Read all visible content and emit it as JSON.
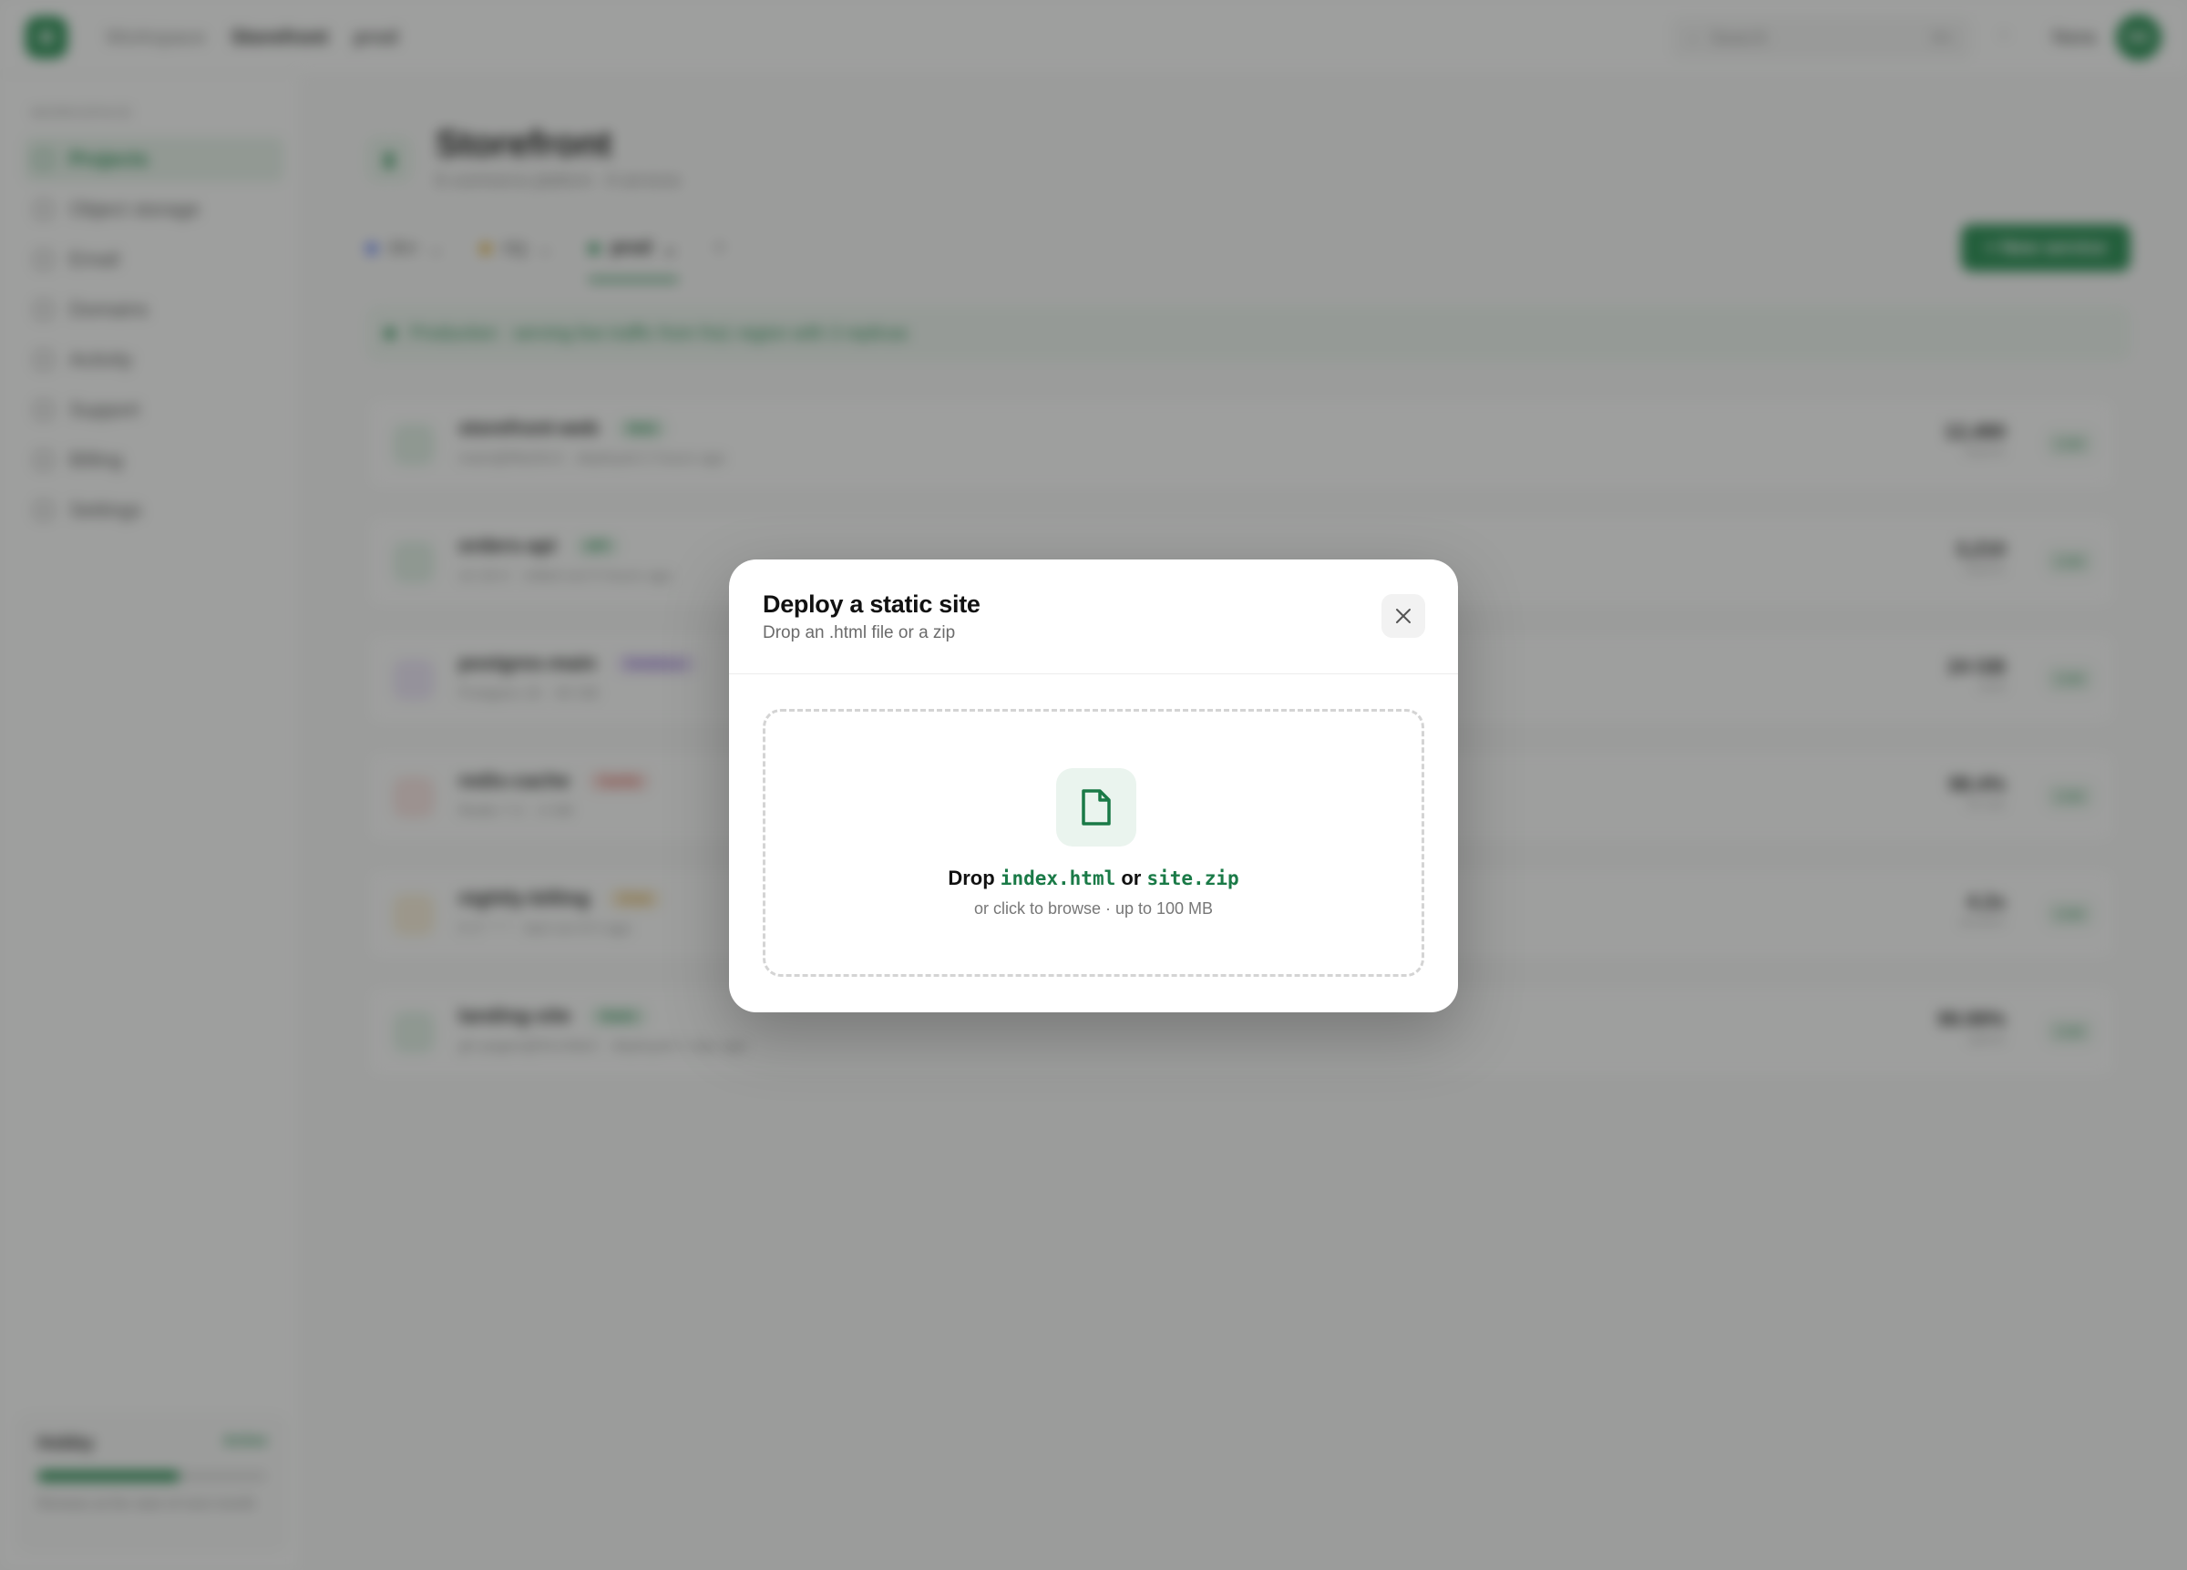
{
  "topbar": {
    "logo_glyph": "✿",
    "breadcrumbs": [
      "Workspace",
      "Storefront",
      "prod"
    ],
    "search_placeholder": "Search",
    "search_shortcut": "⌘K",
    "user_name": "Nora",
    "avatar_initials": "NS"
  },
  "sidebar": {
    "section_label": "Workspace",
    "items": [
      {
        "label": "Projects",
        "active": true
      },
      {
        "label": "Object storage",
        "active": false
      },
      {
        "label": "Email",
        "active": false
      },
      {
        "label": "Domains",
        "active": false
      },
      {
        "label": "Activity",
        "active": false
      },
      {
        "label": "Support",
        "active": false
      },
      {
        "label": "Billing",
        "active": false
      },
      {
        "label": "Settings",
        "active": false
      }
    ],
    "plan": {
      "name": "Hobby",
      "badge": "Active",
      "usage_fraction": 0.62,
      "note": "Renews at the start of next month"
    }
  },
  "main": {
    "project_title": "Storefront",
    "project_subtitle": "E-commerce platform · 6 services",
    "env_tabs": [
      {
        "label": "dev",
        "color": "#4a6cf7",
        "active": false
      },
      {
        "label": "stg",
        "color": "#e0a31b",
        "active": false
      },
      {
        "label": "prod",
        "color": "#1f8a4c",
        "active": true
      }
    ],
    "new_service_label": "+ New service",
    "banner_text": "Production · serving live traffic from fra1 region with 3 replicas",
    "services": [
      {
        "name": "storefront-web",
        "tag": "Web",
        "tag_color": "#1f8a4c",
        "tag_bg": "#e3f2e8",
        "icon_bg": "#e3f2e8",
        "meta": "main@8fa20c3 · deployed 2 hours ago",
        "value": "12,480",
        "unit": "req/min",
        "status": "Live"
      },
      {
        "name": "orders-api",
        "tag": "API",
        "tag_color": "#1f8a4c",
        "tag_bg": "#e3f2e8",
        "icon_bg": "#e3f2e8",
        "meta": "v2.18.4 · rolled out 5 hours ago",
        "value": "3,210",
        "unit": "req/min",
        "status": "Live"
      },
      {
        "name": "postgres-main",
        "tag": "Database",
        "tag_color": "#7a55c9",
        "tag_bg": "#efe8fa",
        "icon_bg": "#efe8fa",
        "meta": "Postgres 16 · 40 GB",
        "value": "24 GB",
        "unit": "used",
        "status": "Live"
      },
      {
        "name": "redis-cache",
        "tag": "Cache",
        "tag_color": "#d1453b",
        "tag_bg": "#fbe7e5",
        "icon_bg": "#fbe7e5",
        "meta": "Redis 7.2 · 2 GB",
        "value": "98.4%",
        "unit": "hit rate",
        "status": "Live"
      },
      {
        "name": "nightly-billing",
        "tag": "Cron",
        "tag_color": "#c98a0f",
        "tag_bg": "#fbf1dc",
        "icon_bg": "#fbf1dc",
        "meta": "0 3 * * * · last run 8 h ago",
        "value": "4.2s",
        "unit": "duration",
        "status": "Live"
      },
      {
        "name": "landing-site",
        "tag": "Static",
        "tag_color": "#1f8a4c",
        "tag_bg": "#e3f2e8",
        "icon_bg": "#e3f2e8",
        "meta": "gh-pages@91c0de2 · deployed 1 day ago",
        "value": "99.99%",
        "unit": "uptime",
        "status": "Live"
      }
    ]
  },
  "modal": {
    "title": "Deploy a static site",
    "subtitle": "Drop an .html file or a zip",
    "close_icon": "close-icon",
    "drop_prefix": "Drop",
    "file_html": "index.html",
    "drop_or": "or",
    "file_zip": "site.zip",
    "hint": "or click to browse · up to 100 MB",
    "accent_color": "#1a7a47"
  }
}
